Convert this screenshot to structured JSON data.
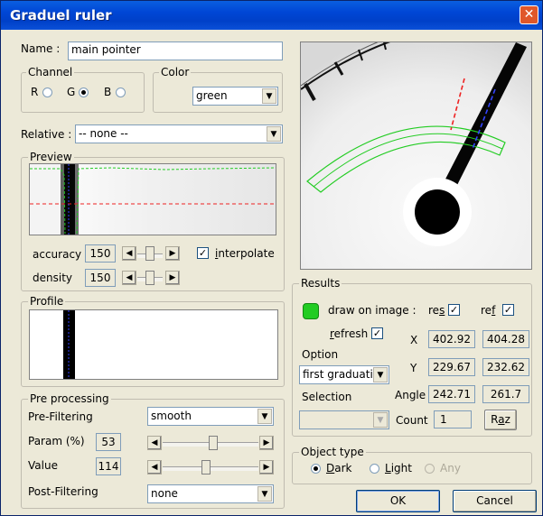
{
  "window": {
    "title": "Graduel ruler",
    "close": "✕"
  },
  "name": {
    "label": "Name :",
    "value": "main pointer"
  },
  "channel": {
    "title": "Channel",
    "r": "R",
    "g": "G",
    "b": "B",
    "selected": "G"
  },
  "color": {
    "title": "Color",
    "value": "green"
  },
  "relative": {
    "label": "Relative :",
    "value": "-- none --"
  },
  "preview": {
    "title": "Preview",
    "accuracy_label": "accuracy",
    "accuracy_value": "150",
    "density_label": "density",
    "density_value": "150",
    "interpolate_label": "interpolate",
    "interpolate_checked": true,
    "accuracy_level": 0.5,
    "density_level": 0.5
  },
  "profile": {
    "title": "Profile"
  },
  "preprocessing": {
    "title": "Pre processing",
    "prefilter_label": "Pre-Filtering",
    "prefilter_value": "smooth",
    "param_label": "Param (%)",
    "param_value": "53",
    "param_level": 0.53,
    "value_label": "Value",
    "value_value": "114",
    "value_level": 0.45,
    "postfilter_label": "Post-Filtering",
    "postfilter_value": "none"
  },
  "results": {
    "title": "Results",
    "draw_label": "draw on image :",
    "res_label": "res",
    "res_checked": true,
    "ref_label": "ref",
    "ref_checked": true,
    "refresh_label": "refresh :",
    "refresh_checked": true,
    "option_label": "Option",
    "option_value": "first graduation",
    "selection_label": "Selection",
    "x_label": "X",
    "x_res": "402.92",
    "x_ref": "404.28",
    "y_label": "Y",
    "y_res": "229.67",
    "y_ref": "232.62",
    "angle_label": "Angle",
    "angle_res": "242.71",
    "angle_ref": "261.7",
    "count_label": "Count",
    "count_value": "1",
    "raz_label": "Raz",
    "indicator_color": "#22cc22"
  },
  "object_type": {
    "title": "Object type",
    "dark": "Dark",
    "light": "Light",
    "any": "Any",
    "selected": "Dark"
  },
  "buttons": {
    "ok": "OK",
    "cancel": "Cancel"
  }
}
